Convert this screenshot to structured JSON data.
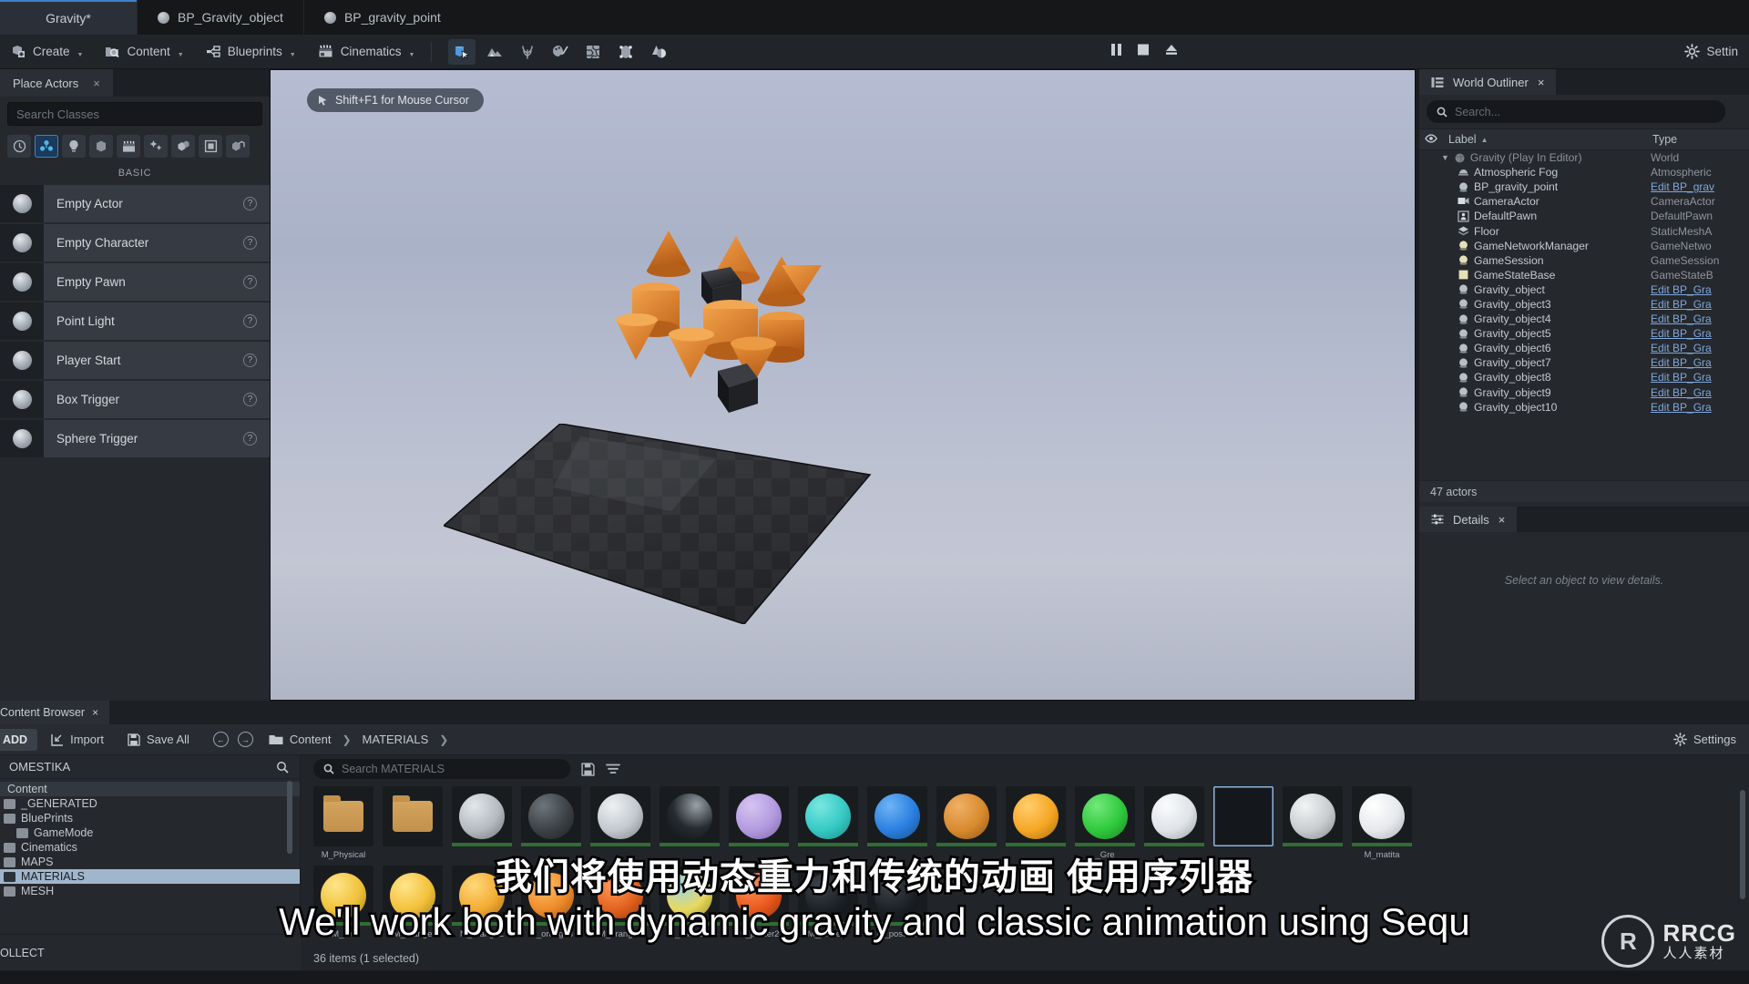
{
  "tabs": {
    "project": {
      "label": "Gravity*"
    },
    "editors": [
      {
        "label": "BP_Gravity_object",
        "icon": "blueprint-dot-icon"
      },
      {
        "label": "BP_gravity_point",
        "icon": "blueprint-dot-icon"
      }
    ]
  },
  "toolbar": {
    "menus": [
      {
        "label": "Create",
        "icon": "create-icon"
      },
      {
        "label": "Content",
        "icon": "content-icon"
      },
      {
        "label": "Blueprints",
        "icon": "blueprints-icon"
      },
      {
        "label": "Cinematics",
        "icon": "cinematics-icon"
      }
    ],
    "mode_icons": [
      {
        "name": "select-mode-icon",
        "active": true
      },
      {
        "name": "landscape-mode-icon",
        "active": false
      },
      {
        "name": "foliage-mode-icon",
        "active": false
      },
      {
        "name": "mesh-paint-mode-icon",
        "active": false
      },
      {
        "name": "fracture-mode-icon",
        "active": false
      },
      {
        "name": "brush-edit-mode-icon",
        "active": false
      },
      {
        "name": "animation-mode-icon",
        "active": false
      }
    ],
    "play_controls": [
      {
        "name": "pause-button",
        "glyph": "pause"
      },
      {
        "name": "stop-button",
        "glyph": "stop"
      },
      {
        "name": "eject-button",
        "glyph": "eject"
      }
    ],
    "settings_label": "Settin"
  },
  "place_actors": {
    "tab_label": "Place Actors",
    "close_label": "×",
    "search_placeholder": "Search Classes",
    "categories": [
      {
        "name": "recently-placed-icon",
        "selected": false
      },
      {
        "name": "basic-icon",
        "selected": true
      },
      {
        "name": "lights-icon",
        "selected": false
      },
      {
        "name": "shapes-icon",
        "selected": false
      },
      {
        "name": "cinematic-icon",
        "selected": false
      },
      {
        "name": "visual-effects-icon",
        "selected": false
      },
      {
        "name": "geometry-icon",
        "selected": false
      },
      {
        "name": "volumes-icon",
        "selected": false
      },
      {
        "name": "all-classes-icon",
        "selected": false
      }
    ],
    "section_title": "BASIC",
    "items": [
      {
        "label": "Empty Actor"
      },
      {
        "label": "Empty Character"
      },
      {
        "label": "Empty Pawn"
      },
      {
        "label": "Point Light"
      },
      {
        "label": "Player Start"
      },
      {
        "label": "Box Trigger"
      },
      {
        "label": "Sphere Trigger"
      }
    ]
  },
  "viewport": {
    "hint": "Shift+F1 for Mouse Cursor"
  },
  "outliner": {
    "tab_label": "World Outliner",
    "close_label": "×",
    "search_placeholder": "Search...",
    "columns": {
      "label": "Label",
      "type": "Type",
      "sort_glyph": "▲"
    },
    "rows": [
      {
        "label": "Gravity (Play In Editor)",
        "type": "World",
        "icon": "world-icon",
        "indent": 0,
        "expander": "⌄",
        "dim": true,
        "link": false
      },
      {
        "label": "Atmospheric Fog",
        "type": "Atmospheric",
        "icon": "fog-icon",
        "indent": 1,
        "link": false
      },
      {
        "label": "BP_gravity_point",
        "type": "Edit BP_grav",
        "icon": "sphere-icon",
        "indent": 1,
        "link": true
      },
      {
        "label": "CameraActor",
        "type": "CameraActor",
        "icon": "camera-icon",
        "indent": 1,
        "link": false
      },
      {
        "label": "DefaultPawn",
        "type": "DefaultPawn",
        "icon": "pawn-icon",
        "indent": 1,
        "link": false
      },
      {
        "label": "Floor",
        "type": "StaticMeshA",
        "icon": "mesh-icon",
        "indent": 1,
        "link": false
      },
      {
        "label": "GameNetworkManager",
        "type": "GameNetwo",
        "icon": "yellow-sphere-icon",
        "indent": 1,
        "link": false
      },
      {
        "label": "GameSession",
        "type": "GameSession",
        "icon": "yellow-sphere-icon",
        "indent": 1,
        "link": false
      },
      {
        "label": "GameStateBase",
        "type": "GameStateB",
        "icon": "yellow-square-icon",
        "indent": 1,
        "link": false
      },
      {
        "label": "Gravity_object",
        "type": "Edit BP_Gra",
        "icon": "sphere-icon",
        "indent": 1,
        "link": true
      },
      {
        "label": "Gravity_object3",
        "type": "Edit BP_Gra",
        "icon": "sphere-icon",
        "indent": 1,
        "link": true
      },
      {
        "label": "Gravity_object4",
        "type": "Edit BP_Gra",
        "icon": "sphere-icon",
        "indent": 1,
        "link": true
      },
      {
        "label": "Gravity_object5",
        "type": "Edit BP_Gra",
        "icon": "sphere-icon",
        "indent": 1,
        "link": true
      },
      {
        "label": "Gravity_object6",
        "type": "Edit BP_Gra",
        "icon": "sphere-icon",
        "indent": 1,
        "link": true
      },
      {
        "label": "Gravity_object7",
        "type": "Edit BP_Gra",
        "icon": "sphere-icon",
        "indent": 1,
        "link": true
      },
      {
        "label": "Gravity_object8",
        "type": "Edit BP_Gra",
        "icon": "sphere-icon",
        "indent": 1,
        "link": true
      },
      {
        "label": "Gravity_object9",
        "type": "Edit BP_Gra",
        "icon": "sphere-icon",
        "indent": 1,
        "link": true
      },
      {
        "label": "Gravity_object10",
        "type": "Edit BP_Gra",
        "icon": "sphere-icon",
        "indent": 1,
        "link": true
      }
    ],
    "actor_count": "47 actors"
  },
  "details": {
    "tab_label": "Details",
    "close_label": "×",
    "empty_text": "Select an object to view details."
  },
  "content_browser": {
    "tab_label": "Content Browser",
    "close_label": "×",
    "add_label": "ADD",
    "import_label": "Import",
    "save_all_label": "Save All",
    "breadcrumb": [
      "Content",
      "MATERIALS"
    ],
    "settings_label": "Settings",
    "sources": {
      "header": "OMESTIKA",
      "tree": [
        {
          "label": "Content",
          "indent": 0,
          "type": "root",
          "state": "dim-selected"
        },
        {
          "label": "_GENERATED",
          "indent": 0,
          "type": "folder",
          "state": ""
        },
        {
          "label": "BluePrints",
          "indent": 0,
          "type": "folder",
          "state": ""
        },
        {
          "label": "GameMode",
          "indent": 1,
          "type": "folder",
          "state": ""
        },
        {
          "label": "Cinematics",
          "indent": 0,
          "type": "folder",
          "state": ""
        },
        {
          "label": "MAPS",
          "indent": 0,
          "type": "folder",
          "state": ""
        },
        {
          "label": "MATERIALS",
          "indent": 0,
          "type": "folder",
          "state": "selected"
        },
        {
          "label": "MESH",
          "indent": 0,
          "type": "folder",
          "state": ""
        }
      ],
      "collections_label": "OLLECT"
    },
    "assets": {
      "search_placeholder": "Search MATERIALS",
      "save_icon": "save-search-icon",
      "filter_icon": "filter-icon",
      "row1": [
        {
          "label": "M_Physical",
          "kind": "folder"
        },
        {
          "label": "",
          "kind": "folder"
        },
        {
          "label": "",
          "kind": "sphere",
          "color": "#b4bac0"
        },
        {
          "label": "",
          "kind": "sphere",
          "color": "#3b4145"
        },
        {
          "label": "",
          "kind": "sphere",
          "color": "#c2c8cd"
        },
        {
          "label": "",
          "kind": "sphere",
          "color": "#252b30"
        },
        {
          "label": "",
          "kind": "sphere",
          "color": "#b39adf"
        },
        {
          "label": "",
          "kind": "sphere",
          "color": "#35c9c4"
        },
        {
          "label": "",
          "kind": "sphere",
          "color": "#2a7fe0"
        },
        {
          "label": "",
          "kind": "sphere",
          "color": "#d88a2e"
        },
        {
          "label": "",
          "kind": "sphere",
          "color": "#f5a623"
        },
        {
          "label": "_Gre",
          "kind": "sphere",
          "color": "#2fc93c"
        },
        {
          "label": "",
          "kind": "sphere",
          "color": "#dfe3e7"
        },
        {
          "label": "",
          "kind": "empty",
          "color": "#14181c",
          "selected": true
        },
        {
          "label": "",
          "kind": "sphere",
          "color": "#c9ccce"
        },
        {
          "label": "M_matita",
          "kind": "sphere",
          "color": "#e6e8ec"
        }
      ],
      "row2": [
        {
          "label": "M_blu",
          "kind": "sphere",
          "color": "#f0c23a"
        },
        {
          "label": "M_orange",
          "kind": "sphere",
          "color": "#f3c13c"
        },
        {
          "label": "M_orange2",
          "kind": "sphere",
          "color": "#f3ab33"
        },
        {
          "label": "M_orange3",
          "kind": "sphere",
          "color": "#ee8b2a"
        },
        {
          "label": "M_orange4",
          "kind": "sphere",
          "color": "#e2621f"
        },
        {
          "label": "_astro1",
          "kind": "sphere",
          "color": "#e8d85f"
        },
        {
          "label": "M_poster2",
          "kind": "sphere",
          "color": "#e9581d"
        },
        {
          "label": "M_poster3",
          "kind": "sphere",
          "color": "#1b1f24"
        },
        {
          "label": "M_poster4",
          "kind": "sphere",
          "color": "#1b1f24"
        }
      ],
      "status": "36 items (1 selected)"
    }
  },
  "subtitles": {
    "chinese": "我们将使用动态重力和传统的动画 使用序列器",
    "english": "We'll work both with dynamic gravity and classic animation using Sequ"
  },
  "watermark": {
    "mark": "R",
    "line1": "RRCG",
    "line2": "人人素材"
  }
}
